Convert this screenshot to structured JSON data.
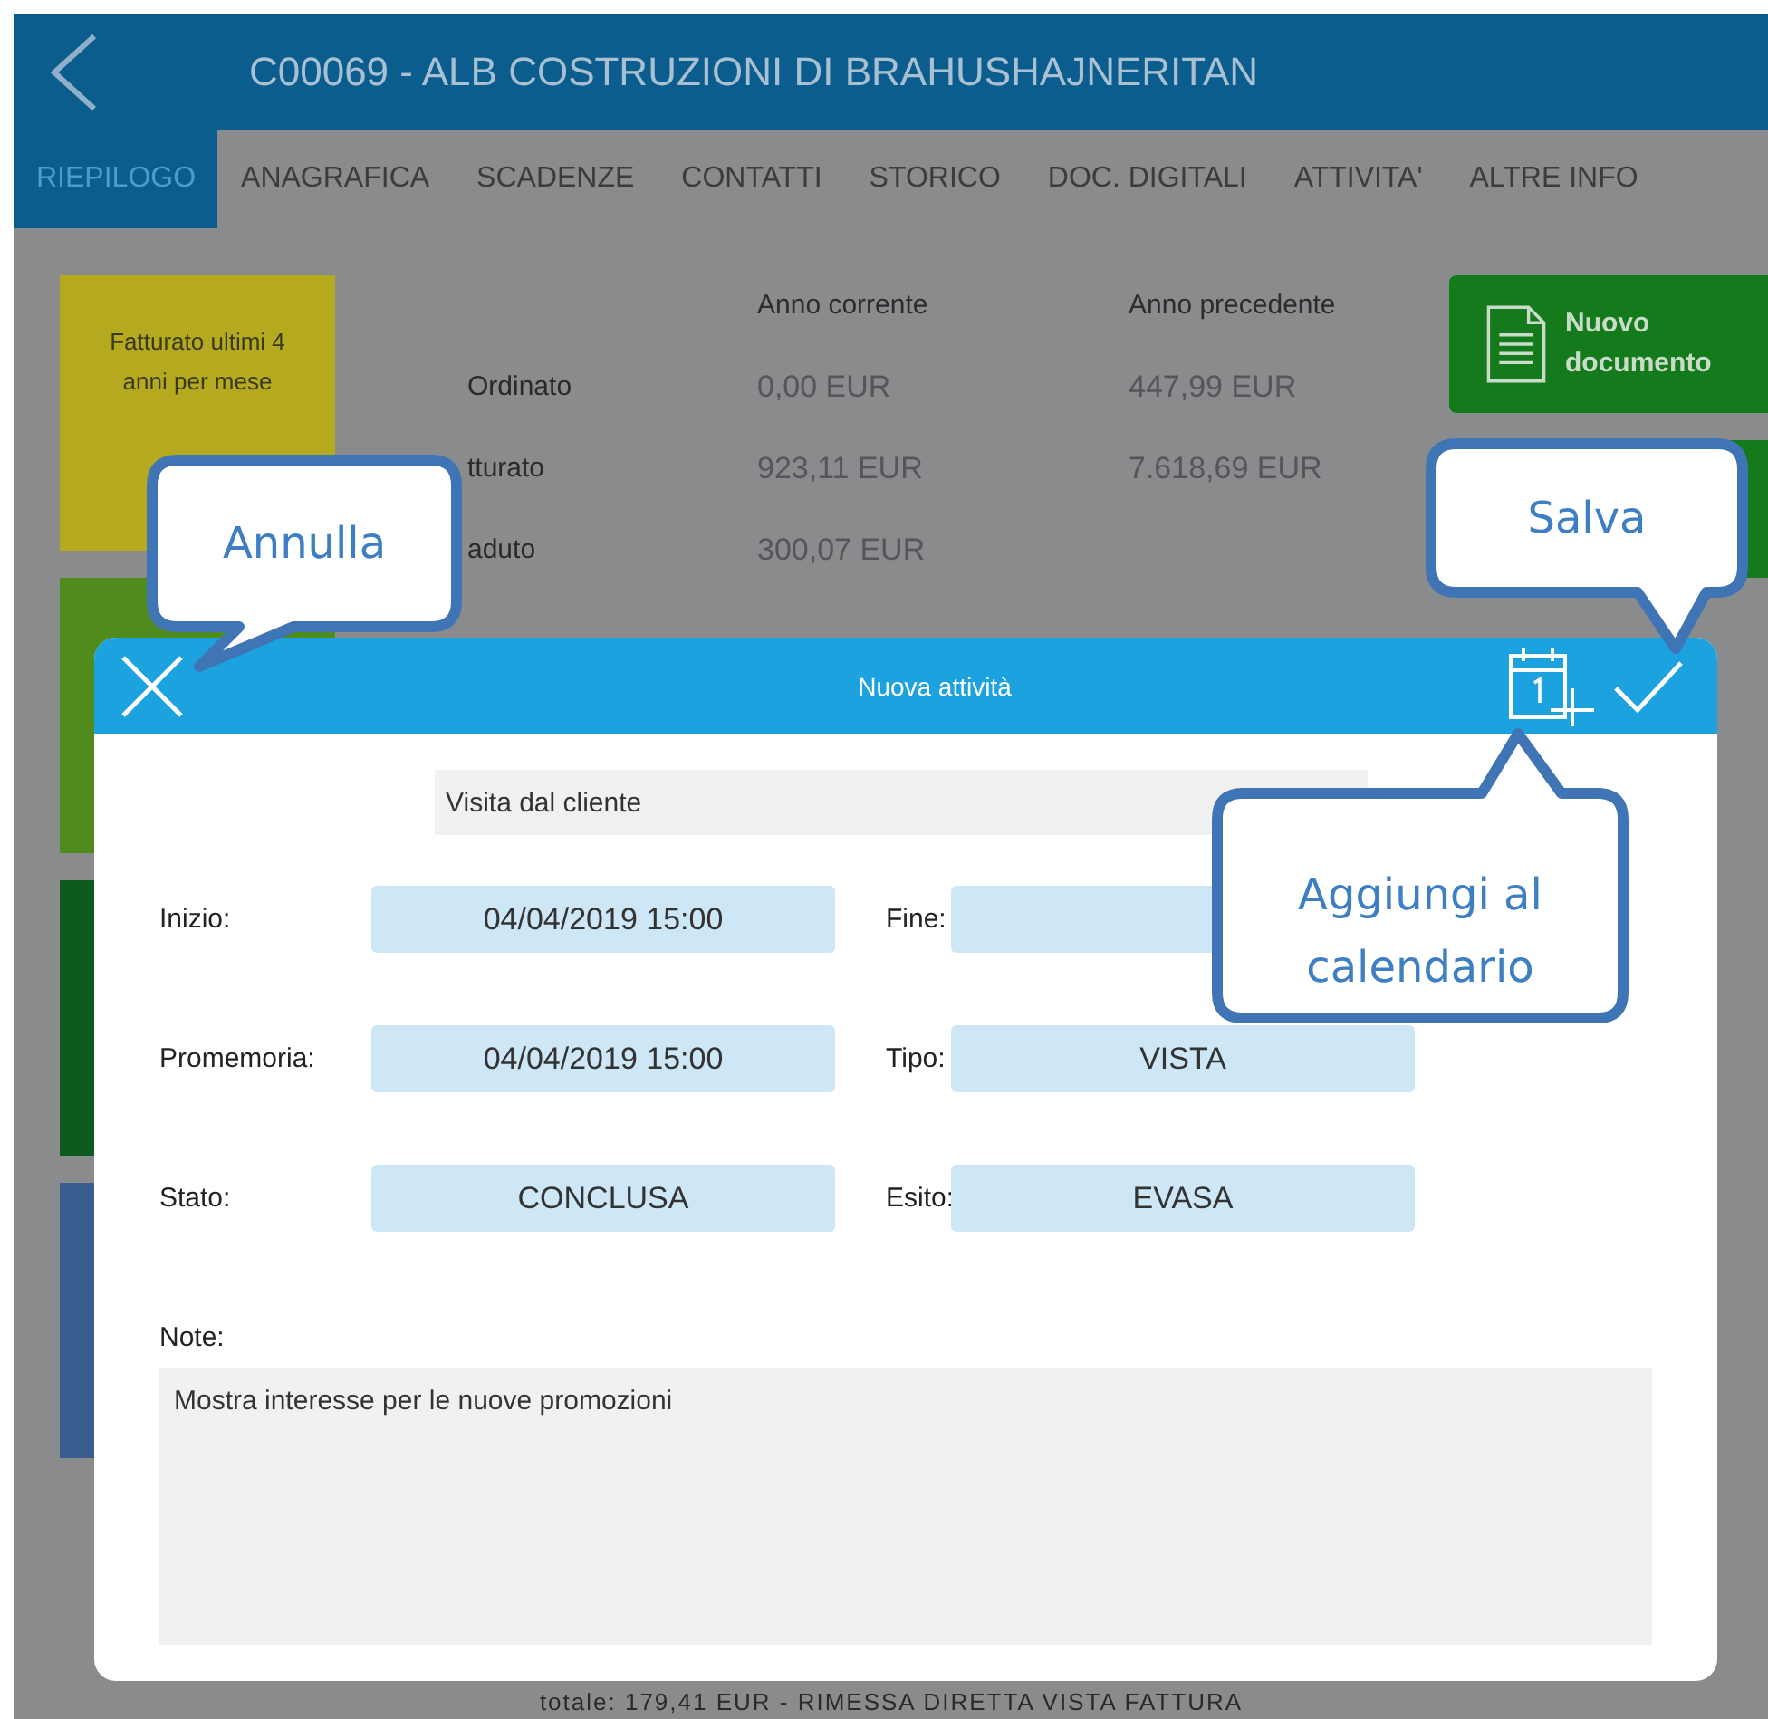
{
  "header": {
    "title": "C00069 - ALB COSTRUZIONI DI BRAHUSHAJNERITAN"
  },
  "tabs": [
    {
      "label": "RIEPILOGO",
      "selected": true
    },
    {
      "label": "ANAGRAFICA",
      "selected": false
    },
    {
      "label": "SCADENZE",
      "selected": false
    },
    {
      "label": "CONTATTI",
      "selected": false
    },
    {
      "label": "STORICO",
      "selected": false
    },
    {
      "label": "DOC. DIGITALI",
      "selected": false
    },
    {
      "label": "ATTIVITA'",
      "selected": false
    },
    {
      "label": "ALTRE INFO",
      "selected": false
    }
  ],
  "tiles": [
    {
      "label": "Fatturato ultimi 4 anni per mese",
      "color": "#b5a91f"
    },
    {
      "color": "#4f8b1d"
    },
    {
      "color": "#0f5b1f"
    },
    {
      "color": "#3a5d91"
    }
  ],
  "summary": {
    "columns": [
      "Anno corrente",
      "Anno precedente"
    ],
    "rows": [
      {
        "label": "Ordinato",
        "values": [
          "0,00 EUR",
          "447,99 EUR"
        ]
      },
      {
        "label": "tturato",
        "values": [
          "923,11 EUR",
          "7.618,69 EUR"
        ]
      },
      {
        "label": "aduto",
        "values": [
          "300,07 EUR"
        ]
      }
    ]
  },
  "actions": [
    {
      "kind": "document",
      "label": "Nuovo documento"
    },
    {
      "kind": "blank"
    }
  ],
  "footer_text": "totale: 179,41 EUR - RIMESSA DIRETTA VISTA FATTURA",
  "dialog": {
    "title": "Nuova attività",
    "subject": "Visita dal cliente",
    "fields": [
      {
        "label": "Inizio:",
        "value": "04/04/2019 15:00"
      },
      {
        "label": "Fine:"
      },
      {
        "label": "Promemoria:",
        "value": "04/04/2019 15:00"
      },
      {
        "label": "Tipo:",
        "value": "VISTA"
      },
      {
        "label": "Stato:",
        "value": "CONCLUSA"
      },
      {
        "label": "Esito:",
        "value": "EVASA"
      }
    ],
    "note_label": "Note:",
    "note": "Mostra interesse per le nuove promozioni"
  },
  "callouts": [
    {
      "text": "Annulla"
    },
    {
      "text": "Salva"
    },
    {
      "text": "Aggiungi al calendario"
    }
  ]
}
